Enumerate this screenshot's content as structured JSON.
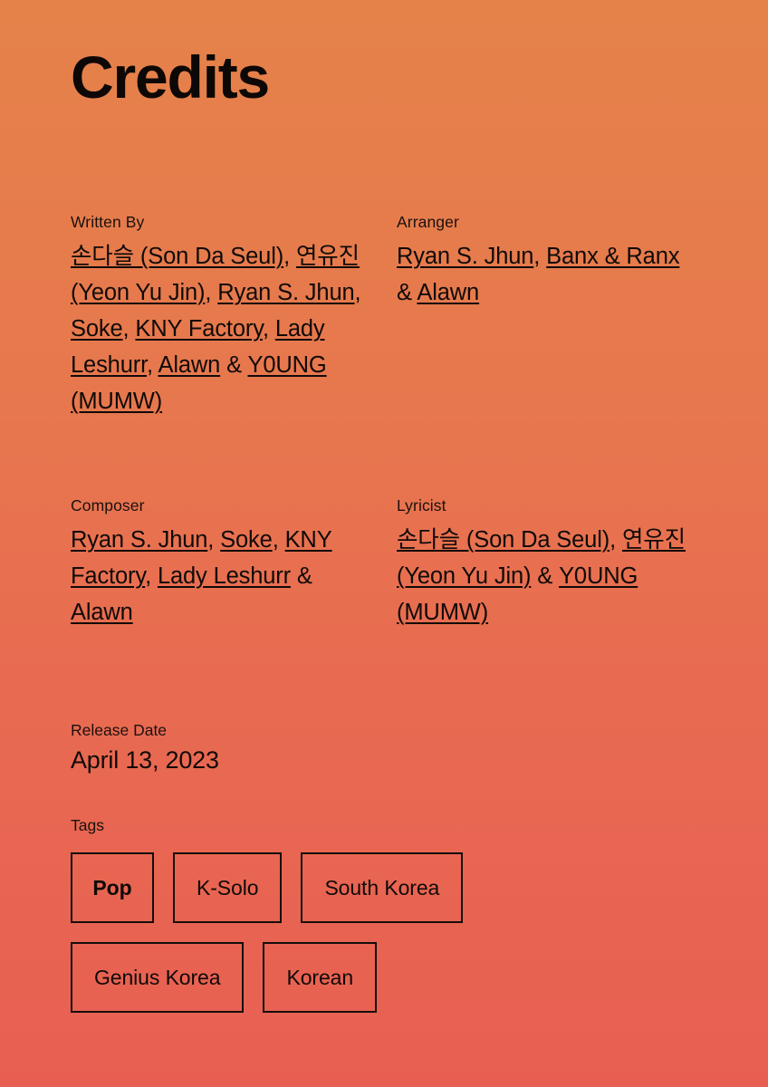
{
  "page": {
    "title": "Credits",
    "background_top": "#E5824A",
    "background_bottom": "#E85F52",
    "text_color": "#100A08"
  },
  "credits": [
    {
      "label": "Written By",
      "value": "손다슬 (Son Da Seul), 연유진 (Yeon Yu Jin), Ryan S. Jhun, Soke, KNY Factory, Lady Leshurr, Alawn & Y0UNG (MUMW)",
      "names": [
        "손다슬 (Son Da Seul)",
        "연유진 (Yeon Yu Jin)",
        "Ryan S. Jhun",
        "Soke",
        "KNY Factory",
        "Lady Leshurr",
        "Alawn",
        "Y0UNG (MUMW)"
      ]
    },
    {
      "label": "Arranger",
      "value": "Ryan S. Jhun, Banx & Ranx & Alawn",
      "names": [
        "Ryan S. Jhun",
        "Banx & Ranx",
        "Alawn"
      ]
    },
    {
      "label": "Composer",
      "value": "Ryan S. Jhun, Soke, KNY Factory, Lady Leshurr & Alawn",
      "names": [
        "Ryan S. Jhun",
        "Soke",
        "KNY Factory",
        "Lady Leshurr",
        "Alawn"
      ]
    },
    {
      "label": "Lyricist",
      "value": "손다슬 (Son Da Seul), 연유진 (Yeon Yu Jin) & Y0UNG (MUMW)",
      "names": [
        "손다슬 (Son Da Seul)",
        "연유진 (Yeon Yu Jin)",
        "Y0UNG (MUMW)"
      ]
    }
  ],
  "release": {
    "label": "Release Date",
    "value": "April 13, 2023"
  },
  "tags": {
    "label": "Tags",
    "items": [
      {
        "label": "Pop",
        "primary": true
      },
      {
        "label": "K-Solo",
        "primary": false
      },
      {
        "label": "South Korea",
        "primary": false
      },
      {
        "label": "Genius Korea",
        "primary": false
      },
      {
        "label": "Korean",
        "primary": false
      }
    ]
  }
}
